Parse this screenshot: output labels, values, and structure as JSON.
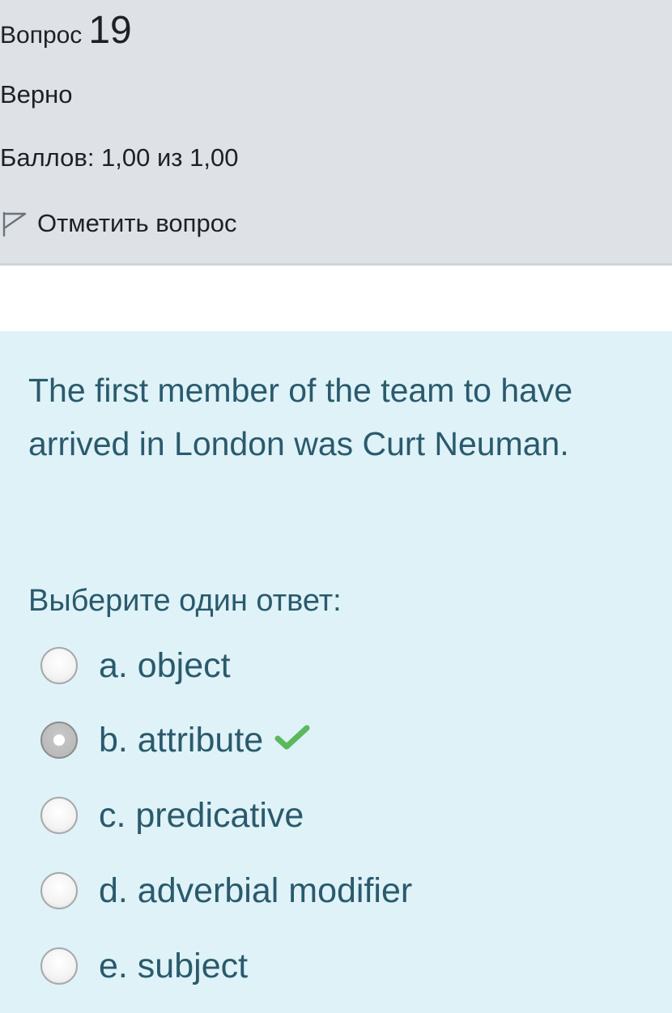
{
  "info": {
    "question_label": "Вопрос",
    "question_number": "19",
    "state": "Верно",
    "grade": "Баллов: 1,00 из 1,00",
    "flag_label": "Отметить вопрос"
  },
  "question": {
    "text": "The first member of the team to have arrived in London was Curt Neuman.",
    "prompt": "Выберите один ответ:"
  },
  "answers": [
    {
      "label": "a. object",
      "selected": false,
      "correct": false
    },
    {
      "label": "b. attribute",
      "selected": true,
      "correct": true
    },
    {
      "label": "c. predicative",
      "selected": false,
      "correct": false
    },
    {
      "label": "d. adverbial modifier",
      "selected": false,
      "correct": false
    },
    {
      "label": "e. subject",
      "selected": false,
      "correct": false
    }
  ],
  "colors": {
    "info_bg": "#dee2e6",
    "content_bg": "#def2f8",
    "text_teal": "#2a5a6c",
    "correct_green": "#5cb85c"
  },
  "icons": {
    "flag": "flag-outline-icon",
    "correct": "check-icon"
  }
}
